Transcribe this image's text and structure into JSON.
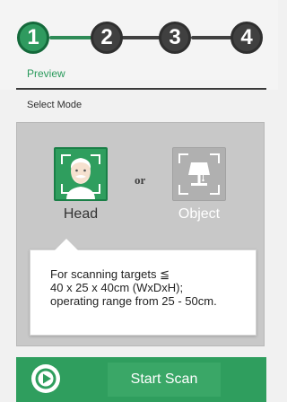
{
  "stepper": {
    "steps": [
      "1",
      "2",
      "3",
      "4"
    ],
    "current_caption": "Preview",
    "active_color": "#2f9a5f",
    "inactive_color": "#404040"
  },
  "section": {
    "label": "Select Mode"
  },
  "modes": {
    "head": {
      "label": "Head",
      "icon": "face-icon",
      "selected": true
    },
    "or_text": "or",
    "object": {
      "label": "Object",
      "icon": "lamp-icon",
      "selected": false
    }
  },
  "info": {
    "lines": [
      "For scanning targets ≦",
      "40 x 25 x 40cm (WxDxH);",
      "operating range from 25 - 50cm."
    ]
  },
  "action": {
    "start_label": "Start Scan",
    "icon": "play-icon",
    "color": "#2f9e5e"
  }
}
